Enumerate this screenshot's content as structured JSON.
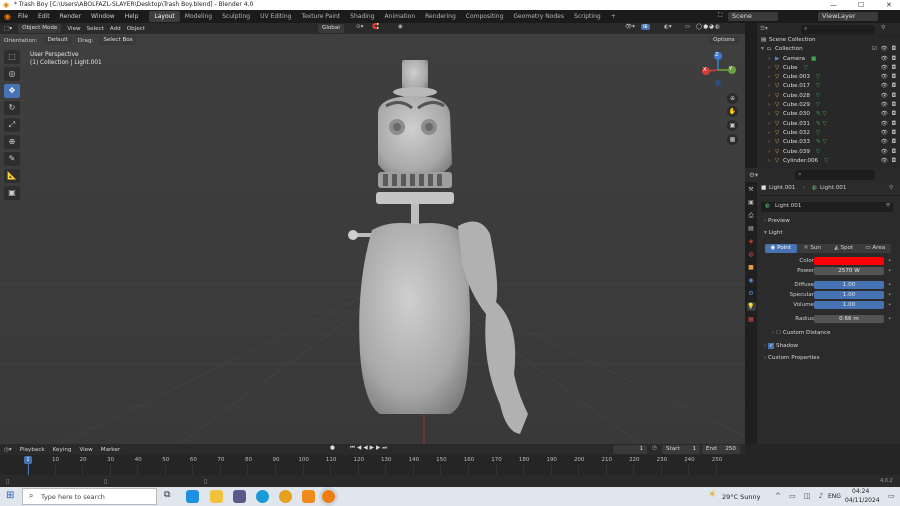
{
  "window": {
    "title": "* Trash Boy [C:\\Users\\ABOLFAZL-SLAYER\\Desktop\\Trash Boy.blend] - Blender 4.0",
    "minimize": "—",
    "maximize": "☐",
    "close": "✕"
  },
  "menu": {
    "items": [
      "File",
      "Edit",
      "Render",
      "Window",
      "Help"
    ],
    "workspaces": [
      "Layout",
      "Modeling",
      "Sculpting",
      "UV Editing",
      "Texture Paint",
      "Shading",
      "Animation",
      "Rendering",
      "Compositing",
      "Geometry Nodes",
      "Scripting"
    ],
    "add_tab": "+",
    "scene_label": "Scene",
    "viewlayer_label": "ViewLayer"
  },
  "viewport_header": {
    "mode": "Object Mode",
    "view": "View",
    "select": "Select",
    "add": "Add",
    "object": "Object",
    "transform": "Global",
    "orientation_label": "Orientation:",
    "orientation_value": "Default",
    "drag_label": "Drag:",
    "drag_value": "Select Box",
    "options": "Options"
  },
  "viewport": {
    "view_name": "User Perspective",
    "context": "(1) Collection | Light.001",
    "gizmo": {
      "x": "X",
      "y": "Y",
      "z": "Z"
    }
  },
  "toolbar": {
    "tools": [
      "select-box-icon",
      "cursor-icon",
      "move-icon",
      "rotate-icon",
      "scale-icon",
      "transform-icon",
      "annotate-icon",
      "measure-icon",
      "add-cube-icon"
    ]
  },
  "outliner": {
    "search_placeholder": "",
    "root": "Scene Collection",
    "collection": "Collection",
    "items": [
      {
        "name": "Camera",
        "icon": "camera-icon",
        "color": "#5a8dd6",
        "mod": "■"
      },
      {
        "name": "Cube",
        "icon": "mesh-icon",
        "color": "#e59a4c",
        "mod": "▽"
      },
      {
        "name": "Cube.003",
        "icon": "mesh-icon",
        "color": "#e59a4c",
        "mod": "▽"
      },
      {
        "name": "Cube.017",
        "icon": "mesh-icon",
        "color": "#e59a4c",
        "mod": "▽"
      },
      {
        "name": "Cube.028",
        "icon": "mesh-icon",
        "color": "#e59a4c",
        "mod": "▽"
      },
      {
        "name": "Cube.029",
        "icon": "mesh-icon",
        "color": "#e59a4c",
        "mod": "▽"
      },
      {
        "name": "Cube.030",
        "icon": "mesh-icon",
        "color": "#e59a4c",
        "mod": "✎ ▽"
      },
      {
        "name": "Cube.031",
        "icon": "mesh-icon",
        "color": "#e59a4c",
        "mod": "✎ ▽"
      },
      {
        "name": "Cube.032",
        "icon": "mesh-icon",
        "color": "#e59a4c",
        "mod": "▽"
      },
      {
        "name": "Cube.033",
        "icon": "mesh-icon",
        "color": "#e59a4c",
        "mod": "✎ ▽"
      },
      {
        "name": "Cube.039",
        "icon": "mesh-icon",
        "color": "#e59a4c",
        "mod": "▽"
      },
      {
        "name": "Cylinder.006",
        "icon": "mesh-icon",
        "color": "#e59a4c",
        "mod": "▽"
      }
    ]
  },
  "properties": {
    "breadcrumb_object": "Light.001",
    "breadcrumb_data": "Light.001",
    "datablock": "Light.001",
    "preview": "Preview",
    "light_section": "Light",
    "light_types": [
      "Point",
      "Sun",
      "Spot",
      "Area"
    ],
    "active_type": "Point",
    "color_label": "Color",
    "color_value": "#ff0000",
    "power_label": "Power",
    "power_value": "2570 W",
    "diffuse_label": "Diffuse",
    "diffuse_value": "1.00",
    "specular_label": "Specular",
    "specular_value": "1.00",
    "volume_label": "Volume",
    "volume_value": "1.00",
    "radius_label": "Radius",
    "radius_value": "0.66 m",
    "custom_distance": "Custom Distance",
    "shadow": "Shadow",
    "custom_properties": "Custom Properties"
  },
  "timeline": {
    "playback": "Playback",
    "keying": "Keying",
    "view": "View",
    "marker": "Marker",
    "current_frame": "1",
    "start_label": "Start",
    "start_value": "1",
    "end_label": "End",
    "end_value": "250",
    "ticks": [
      "0",
      "10",
      "20",
      "30",
      "40",
      "50",
      "60",
      "70",
      "80",
      "90",
      "100",
      "110",
      "120",
      "130",
      "140",
      "150",
      "160",
      "170",
      "180",
      "190",
      "200",
      "210",
      "220",
      "230",
      "240",
      "250"
    ],
    "playhead": "1"
  },
  "status": {
    "version": "4.0.2"
  },
  "taskbar": {
    "search_placeholder": "Type here to search",
    "weather": "29°C  Sunny",
    "lang": "ENG",
    "time": "04:24",
    "date": "04/11/2024"
  }
}
